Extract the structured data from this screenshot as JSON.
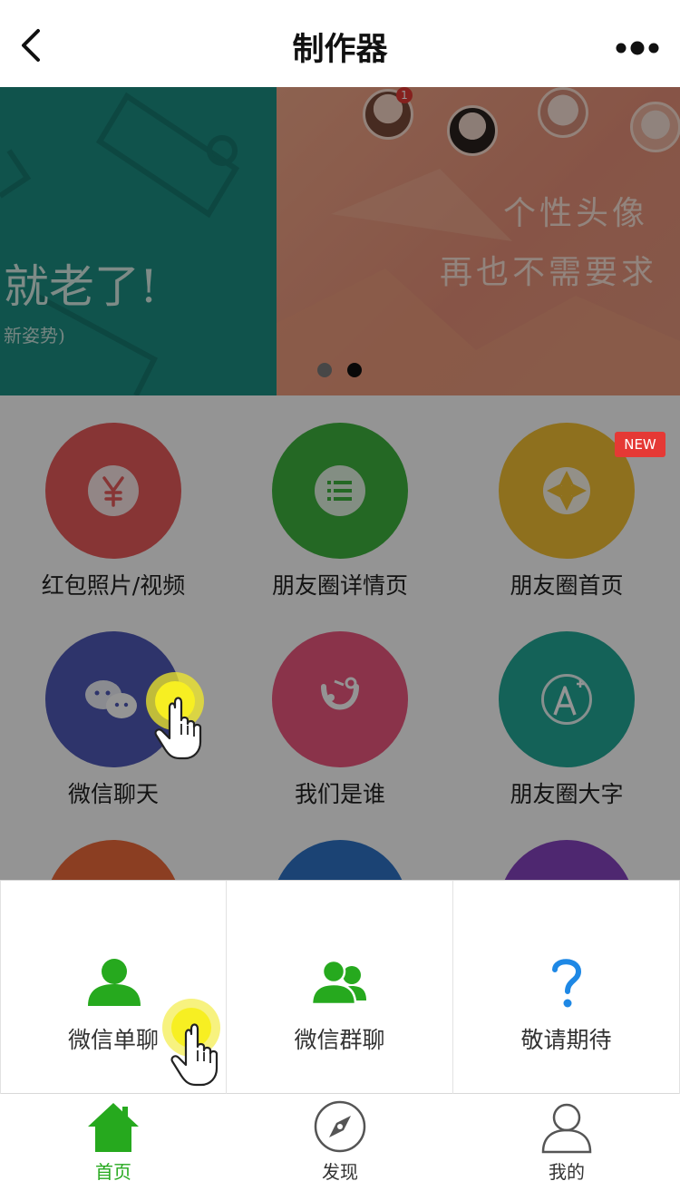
{
  "header": {
    "title": "制作器"
  },
  "banner": {
    "left_line1": "就老了!",
    "left_line2": "新姿势)",
    "right_line1": "个性头像",
    "right_line2": "再也不需要求",
    "avatar_badge": "1",
    "active_slide": 2,
    "slide_count": 2
  },
  "grid": {
    "items": [
      {
        "label": "红包照片/视频",
        "color": "#e85c5c",
        "icon": "yuan-icon"
      },
      {
        "label": "朋友圈详情页",
        "color": "#3fb33f",
        "icon": "list-icon"
      },
      {
        "label": "朋友圈首页",
        "color": "#f5c234",
        "icon": "aperture-icon"
      },
      {
        "label": "微信聊天",
        "color": "#505ab8",
        "icon": "chat-bubbles-icon"
      },
      {
        "label": "我们是谁",
        "color": "#ee5880",
        "icon": "character-icon"
      },
      {
        "label": "朋友圈大字",
        "color": "#23a998",
        "icon": "font-plus-icon"
      }
    ],
    "partial_colors": [
      "#ef6b3b",
      "#2f74c9",
      "#8744c2"
    ],
    "new_badge": "NEW"
  },
  "sheet": {
    "items": [
      {
        "label": "微信单聊",
        "icon": "person-icon",
        "color": "#26a91e"
      },
      {
        "label": "微信群聊",
        "icon": "group-icon",
        "color": "#26a91e"
      },
      {
        "label": "敬请期待",
        "icon": "question-icon",
        "color": "#1e88e5"
      }
    ]
  },
  "tabbar": {
    "items": [
      {
        "label": "首页",
        "icon": "home-icon",
        "active": true
      },
      {
        "label": "发现",
        "icon": "compass-icon",
        "active": false
      },
      {
        "label": "我的",
        "icon": "user-icon",
        "active": false
      }
    ],
    "active_color": "#26a91e"
  }
}
